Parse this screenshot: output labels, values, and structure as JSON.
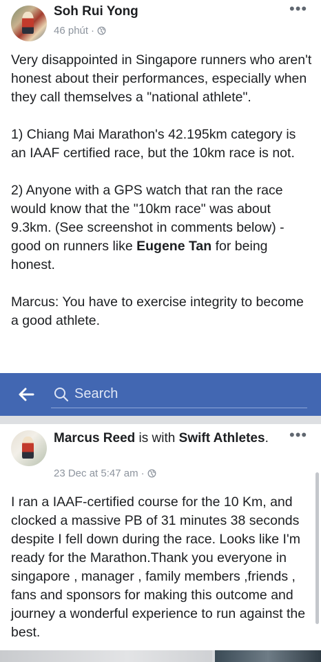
{
  "post1": {
    "author": "Soh Rui Yong",
    "time": "46 phút",
    "dot": "·",
    "paragraphs": {
      "p1": "Very disappointed in Singapore runners who aren't honest about their performances, especially when they call themselves a \"national athlete\".",
      "p2": "1) Chiang Mai Marathon's 42.195km category is an IAAF certified race, but the 10km race is not.",
      "p3_before": "2) Anyone with a GPS watch that ran the race would know that the \"10km race\" was about 9.3km. (See screenshot in comments below) - good on runners like ",
      "p3_bold": "Eugene Tan",
      "p3_after": " for being honest.",
      "p4": "Marcus: You have to exercise integrity to become a good athlete."
    }
  },
  "navbar": {
    "search_label": "Search",
    "color": "#4267b2"
  },
  "post2": {
    "author": "Marcus Reed",
    "with_text": " is with ",
    "group": "Swift Athletes",
    "period": ".",
    "time": "23 Dec at 5:47 am",
    "dot": "·",
    "body": "I ran a IAAF-certified course for the 10 Km, and clocked a massive PB of 31 minutes 38 seconds despite I fell down during the race. Looks like I'm ready for the Marathon.Thank you everyone in singapore , manager , family members ,friends , fans and sponsors for making this outcome and journey a wonderful experience to run against the best."
  },
  "icons": [
    "globe-icon",
    "more-options-icon",
    "back-arrow-icon",
    "search-icon"
  ]
}
